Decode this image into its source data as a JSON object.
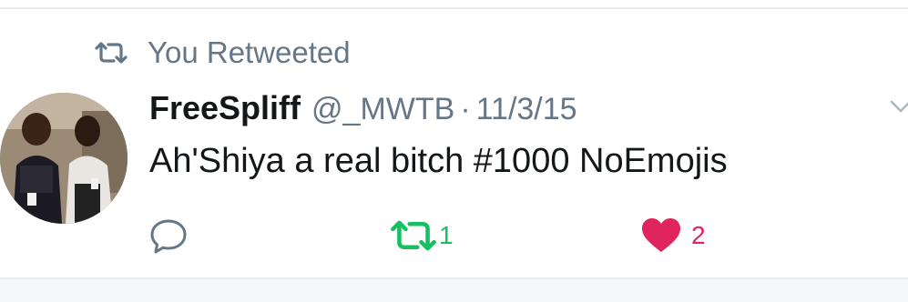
{
  "context": {
    "label": "You Retweeted",
    "icon": "retweet-icon"
  },
  "tweet": {
    "display_name": "FreeSpliff",
    "handle": "@_MWTB",
    "separator": "·",
    "date": "11/3/15",
    "text": "Ah'Shiya a real bitch #1000 NoEmojis",
    "avatar_icon": "avatar-photo"
  },
  "actions": {
    "reply": {
      "icon": "reply-icon",
      "count": ""
    },
    "retweet": {
      "icon": "retweet-icon",
      "count": "1",
      "active": true
    },
    "like": {
      "icon": "heart-icon",
      "count": "2",
      "active": true
    }
  },
  "colors": {
    "text_primary": "#14171a",
    "text_secondary": "#657786",
    "retweet_green": "#17bf63",
    "like_red": "#e0245e",
    "border": "#e6ecf0"
  }
}
